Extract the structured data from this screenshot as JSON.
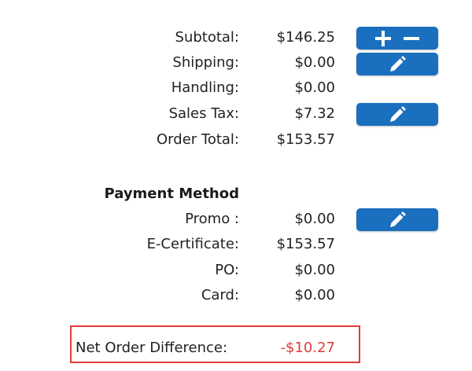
{
  "totals": {
    "subtotal": {
      "label": "Subtotal:",
      "value": "$146.25"
    },
    "shipping": {
      "label": "Shipping:",
      "value": "$0.00"
    },
    "handling": {
      "label": "Handling:",
      "value": "$0.00"
    },
    "sales_tax": {
      "label": "Sales Tax:",
      "value": "$7.32"
    },
    "order_total": {
      "label": "Order Total:",
      "value": "$153.57"
    }
  },
  "payment": {
    "heading": "Payment Method",
    "promo": {
      "label": "Promo :",
      "value": "$0.00"
    },
    "ecert": {
      "label": "E-Certificate:",
      "value": "$153.57"
    },
    "po": {
      "label": "PO:",
      "value": "$0.00"
    },
    "card": {
      "label": "Card:",
      "value": "$0.00"
    }
  },
  "net_difference": {
    "label": "Net Order Difference:",
    "value": "-$10.27"
  },
  "colors": {
    "button_bg": "#1a6fbf",
    "negative": "#e03c3c",
    "highlight_border": "#e03c3c"
  },
  "icons": {
    "subtotal_button": [
      "plus-icon",
      "minus-icon"
    ],
    "edit_button": "pencil-icon"
  }
}
